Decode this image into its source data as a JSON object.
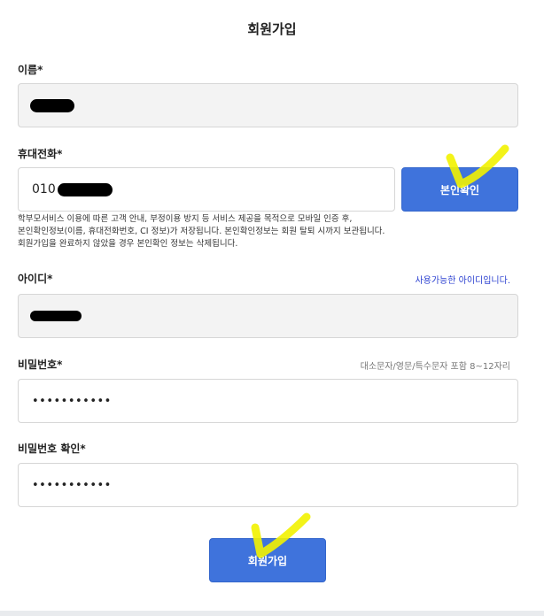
{
  "page": {
    "title": "회원가입"
  },
  "form": {
    "name": {
      "label": "이름*",
      "value_redacted": true
    },
    "phone": {
      "label": "휴대전화*",
      "prefix": "010",
      "verify_button": "본인확인"
    },
    "notice": [
      "학부모서비스 이용에 따른 고객 안내, 부정이용 방지 등 서비스 제공을 목적으로 모바일 인증 후,",
      "본인확인정보(이름, 휴대전화번호, CI 정보)가 저장됩니다. 본인확인정보는 회원 탈퇴 시까지 보관됩니다.",
      "회원가입을 완료하지 않았을 경우 본인확인 정보는 삭제됩니다."
    ],
    "user_id": {
      "label": "아이디*",
      "status": "사용가능한 아이디입니다."
    },
    "password": {
      "label": "비밀번호*",
      "rule": "대소문자/영문/특수문자 포함 8~12자리",
      "masked_value": "•••••••••••"
    },
    "password_confirm": {
      "label": "비밀번호 확인*",
      "masked_value": "•••••••••••"
    },
    "submit_button": "회원가입"
  },
  "colors": {
    "primary": "#3f73dc",
    "readonly_bg": "#f3f3f3",
    "ok_text": "#2a3fd0",
    "annotation": "#f2f200"
  }
}
